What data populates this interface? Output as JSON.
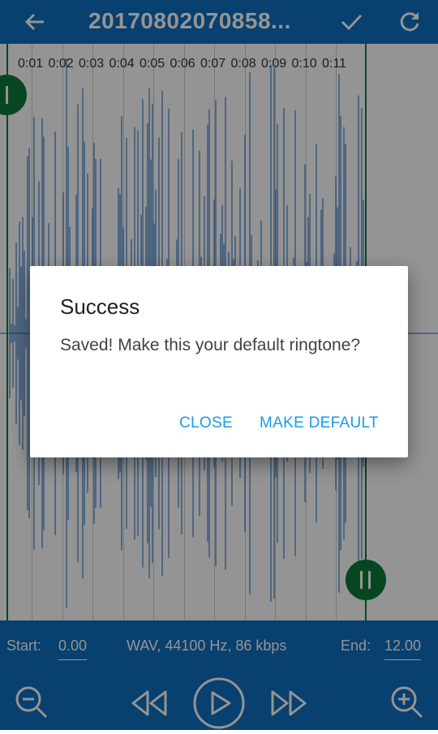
{
  "app_bar": {
    "title": "20170802070858...",
    "back_icon": "arrow-left-icon",
    "confirm_icon": "check-icon",
    "reset_icon": "refresh-icon"
  },
  "timeline": {
    "ticks": [
      "0:01",
      "0:02",
      "0:03",
      "0:04",
      "0:05",
      "0:06",
      "0:07",
      "0:08",
      "0:09",
      "0:10",
      "0:11"
    ]
  },
  "bottom_bar": {
    "start_label": "Start:",
    "start_value": "0.00",
    "info": "WAV, 44100 Hz, 86 kbps",
    "end_label": "End:",
    "end_value": "12.00"
  },
  "controls": {
    "zoom_out_icon": "zoom-out-icon",
    "rewind_icon": "rewind-icon",
    "play_icon": "play-icon",
    "fast_forward_icon": "fast-forward-icon",
    "zoom_in_icon": "zoom-in-icon"
  },
  "dialog": {
    "title": "Success",
    "message": "Saved! Make this your default ringtone?",
    "close_label": "CLOSE",
    "make_default_label": "MAKE DEFAULT"
  },
  "colors": {
    "primary": "#0e6fbf",
    "waveform": "#1565c0",
    "marker": "#0b7a3a",
    "dialog_button": "#1a9ae6"
  }
}
